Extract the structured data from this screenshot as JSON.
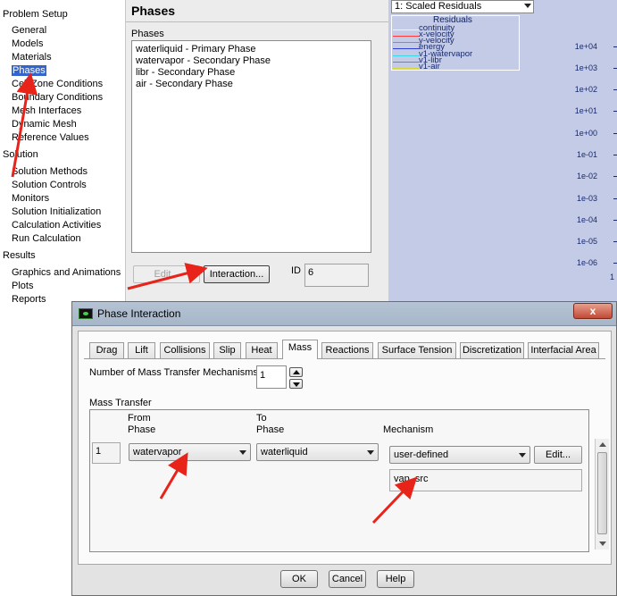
{
  "tree": {
    "problem_setup": "Problem Setup",
    "setup_items": [
      "General",
      "Models",
      "Materials",
      "Phases",
      "Cell Zone Conditions",
      "Boundary Conditions",
      "Mesh Interfaces",
      "Dynamic Mesh",
      "Reference Values"
    ],
    "solution": "Solution",
    "solution_items": [
      "Solution Methods",
      "Solution Controls",
      "Monitors",
      "Solution Initialization",
      "Calculation Activities",
      "Run Calculation"
    ],
    "results": "Results",
    "results_items": [
      "Graphics and Animations",
      "Plots",
      "Reports"
    ]
  },
  "phases_panel": {
    "title": "Phases",
    "list_label": "Phases",
    "list": [
      "waterliquid - Primary Phase",
      "watervapor - Secondary Phase",
      "libr - Secondary Phase",
      "air - Secondary Phase"
    ],
    "edit_button": "Edit...",
    "interaction_button": "Interaction...",
    "id_label": "ID",
    "id_value": "6"
  },
  "plot": {
    "dropdown": "1: Scaled Residuals",
    "legend_title": "Residuals",
    "legend": [
      {
        "name": "continuity",
        "color": "#f5f5f5"
      },
      {
        "name": "x-velocity",
        "color": "#ff3b3b"
      },
      {
        "name": "y-velocity",
        "color": "#2ecc40"
      },
      {
        "name": "energy",
        "color": "#2f3fd0"
      },
      {
        "name": "v1-watervapor",
        "color": "#3cd6e6"
      },
      {
        "name": "v1-libr",
        "color": "#e040e0"
      },
      {
        "name": "v1-air",
        "color": "#d8d83a"
      }
    ],
    "yticks": [
      "1e+04",
      "1e+03",
      "1e+02",
      "1e+01",
      "1e+00",
      "1e-01",
      "1e-02",
      "1e-03",
      "1e-04",
      "1e-05",
      "1e-06"
    ],
    "x_tick": "1"
  },
  "dialog": {
    "title": "Phase Interaction",
    "close_label": "x",
    "tabs": [
      "Drag",
      "Lift",
      "Collisions",
      "Slip",
      "Heat",
      "Mass",
      "Reactions",
      "Surface Tension",
      "Discretization",
      "Interfacial Area"
    ],
    "active_tab": "Mass",
    "num_mechanisms_label": "Number of Mass Transfer Mechanisms",
    "num_mechanisms_value": "1",
    "mass_transfer_label": "Mass Transfer",
    "headers": {
      "from_line1": "From",
      "from_line2": "Phase",
      "to_line1": "To",
      "to_line2": "Phase",
      "mechanism": "Mechanism"
    },
    "row": {
      "index": "1",
      "from_phase": "watervapor",
      "to_phase": "waterliquid",
      "mechanism": "user-defined",
      "edit_button": "Edit...",
      "udf": "vap_src"
    },
    "ok": "OK",
    "cancel": "Cancel",
    "help": "Help"
  },
  "colors": {
    "selection": "#3366cc",
    "plot_background": "#c3cbe7",
    "annotation_arrow": "#e8231a"
  }
}
